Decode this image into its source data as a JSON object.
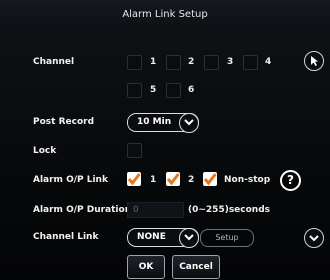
{
  "title": "Alarm Link Setup",
  "channel": {
    "label": "Channel",
    "options": [
      "1",
      "2",
      "3",
      "4",
      "5",
      "6"
    ]
  },
  "post_record": {
    "label": "Post Record",
    "value": "10 Min"
  },
  "lock": {
    "label": "Lock"
  },
  "alarm_op_link": {
    "label": "Alarm O/P Link",
    "opt1": "1",
    "opt2": "2",
    "nonstop": "Non-stop"
  },
  "alarm_op_duration": {
    "label": "Alarm O/P Duration",
    "value": "0",
    "hint": "(0~255)seconds"
  },
  "channel_link": {
    "label": "Channel Link",
    "value": "NONE",
    "setup": "Setup"
  },
  "buttons": {
    "ok": "OK",
    "cancel": "Cancel"
  },
  "help_symbol": "?",
  "colors": {
    "checkmark": "#e8771b",
    "background": "#07090b"
  }
}
